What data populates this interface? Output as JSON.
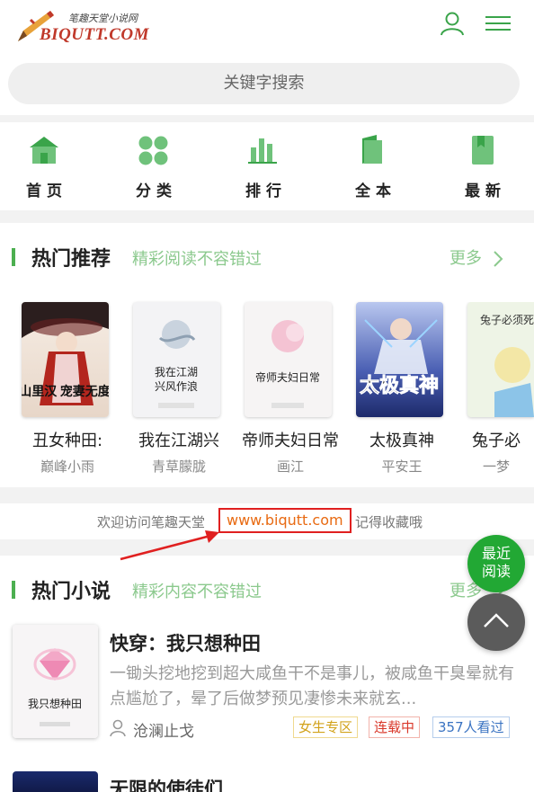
{
  "header": {
    "logo_sub": "笔趣天堂小说网",
    "logo_main": "BIQUTT.COM",
    "search_placeholder": "关键字搜索"
  },
  "nav": [
    {
      "label": "首页",
      "icon": "home-icon"
    },
    {
      "label": "分类",
      "icon": "category-icon"
    },
    {
      "label": "排行",
      "icon": "ranking-icon"
    },
    {
      "label": "全本",
      "icon": "complete-books-icon"
    },
    {
      "label": "最新",
      "icon": "latest-icon"
    }
  ],
  "hot_recommend": {
    "title": "热门推荐",
    "subtitle": "精彩阅读不容错过",
    "more": "更多",
    "books": [
      {
        "title": "丑女种田:",
        "author": "巅峰小雨",
        "cover_text": "山里汉 宠妻无度"
      },
      {
        "title": "我在江湖兴",
        "author": "青草朦胧",
        "cover_text": "我在江湖 兴风作浪"
      },
      {
        "title": "帝师夫妇日常",
        "author": "画江",
        "cover_text": "帝师夫妇日常"
      },
      {
        "title": "太极真神",
        "author": "平安王",
        "cover_text": "太极真神"
      },
      {
        "title": "兔子必",
        "author": "一梦",
        "cover_text": "兔子必须死"
      }
    ]
  },
  "welcome": {
    "prefix": "欢迎访问笔趣天堂",
    "url": "www.biqutt.com",
    "suffix": "记得收藏哦"
  },
  "hot_novels": {
    "title": "热门小说",
    "subtitle": "精彩内容不容错过",
    "more": "更多",
    "items": [
      {
        "title": "快穿：我只想种田",
        "desc": "一锄头挖地挖到超大咸鱼干不是事儿，被咸鱼干臭晕就有点尴尬了，晕了后做梦预见凄惨未来就玄...",
        "author": "沧澜止戈",
        "cover_text": "我只想种田",
        "tags": [
          "女生专区",
          "连载中",
          "357人看过"
        ]
      },
      {
        "title": "无限的使徒们"
      }
    ]
  },
  "float": {
    "recent_label": "最近阅读"
  },
  "colors": {
    "accent": "#4caf50",
    "accent_light": "#8bc98d",
    "highlight_border": "#e02020",
    "url_text": "#e86a12",
    "float_green": "#22a834"
  }
}
